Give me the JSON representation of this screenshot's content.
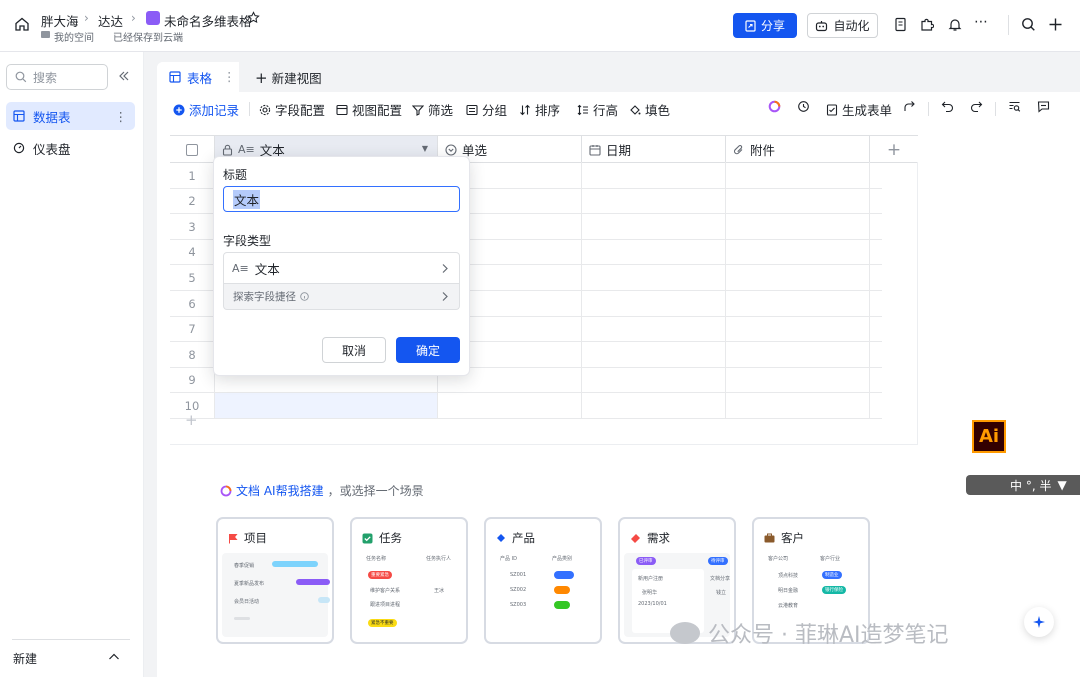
{
  "header": {
    "breadcrumb": [
      "胖大海",
      "达达"
    ],
    "doc_title": "未命名多维表格",
    "space": "我的空间",
    "save_status": "已经保存到云端",
    "share_label": "分享",
    "automation_label": "自动化"
  },
  "sidebar": {
    "search_placeholder": "搜索",
    "items": [
      {
        "label": "数据表"
      },
      {
        "label": "仪表盘"
      }
    ],
    "new_label": "新建"
  },
  "tabs": {
    "table_label": "表格",
    "new_view_label": "新建视图"
  },
  "toolbar": {
    "add_record": "添加记录",
    "field_config": "字段配置",
    "view_config": "视图配置",
    "filter": "筛选",
    "group": "分组",
    "sort": "排序",
    "row_height": "行高",
    "fill_color": "填色",
    "generate_form": "生成表单"
  },
  "grid": {
    "columns": [
      "文本",
      "单选",
      "日期",
      "附件"
    ],
    "rows": [
      "1",
      "2",
      "3",
      "4",
      "5",
      "6",
      "7",
      "8",
      "9",
      "10"
    ]
  },
  "popup": {
    "title_label": "标题",
    "title_value": "文本",
    "type_label": "字段类型",
    "type_value": "文本",
    "explore": "探索字段捷径",
    "cancel": "取消",
    "confirm": "确定"
  },
  "ai": {
    "link": "文档 AI帮我搭建",
    "rest": "，或选择一个场景"
  },
  "scenarios": [
    {
      "label": "项目"
    },
    {
      "label": "任务"
    },
    {
      "label": "产品"
    },
    {
      "label": "需求"
    },
    {
      "label": "客户"
    }
  ],
  "scenario_previews": {
    "project_rows": [
      "春季促销",
      "夏季新品发布",
      "会员日活动"
    ],
    "task_headers": [
      "任务名称",
      "任务执行人"
    ],
    "task_tags": [
      "重要紧急",
      "紧急不重要"
    ],
    "task_rows": [
      "维护客户关系",
      "跟进项目进程"
    ],
    "task_people": [
      "王冰"
    ],
    "product_headers": [
      "产品 ID",
      "产品类别"
    ],
    "product_ids": [
      "SZ001",
      "SZ002",
      "SZ003"
    ],
    "req_tags": [
      "已评审",
      "待评审"
    ],
    "req_texts": [
      "新用户注册",
      "文档分享",
      "张明华",
      "2023/10/01",
      "钱立"
    ],
    "customer_headers": [
      "客户公司",
      "客户行业"
    ],
    "customer_rows": [
      "顶点科技",
      "明日金融",
      "云港教育"
    ],
    "customer_tags": [
      "制造业",
      "银行保险"
    ]
  },
  "overlay": {
    "ai_badge": "Ai",
    "ime": "中 °, 半",
    "watermark": "公众号 · 菲琳AI造梦笔记"
  },
  "colors": {
    "primary": "#1456f0",
    "selection": "#e1eaff",
    "doc_icon": "#8b5cf6"
  }
}
